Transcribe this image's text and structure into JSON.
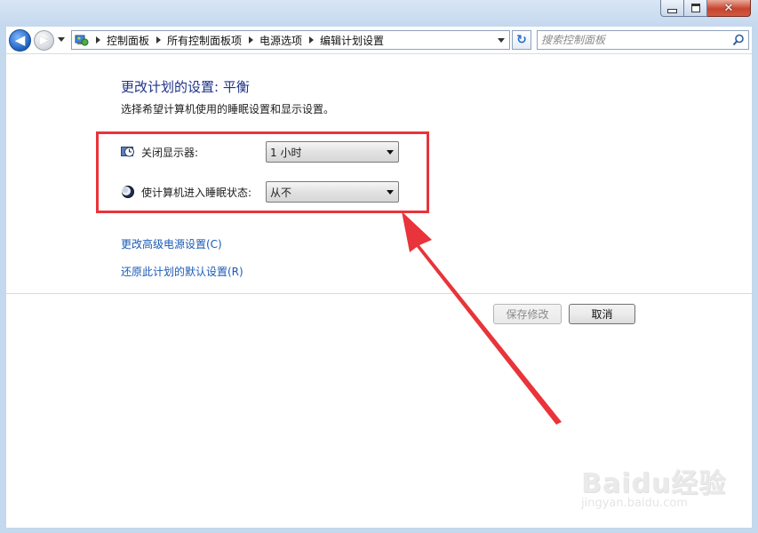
{
  "window": {
    "minimize_icon": "minimize-icon",
    "maximize_icon": "maximize-icon",
    "close_glyph": "✕"
  },
  "nav": {
    "back_glyph": "◀",
    "forward_glyph": "▶",
    "breadcrumbs": [
      "控制面板",
      "所有控制面板项",
      "电源选项",
      "编辑计划设置"
    ],
    "refresh_glyph": "↻",
    "search_placeholder": "搜索控制面板"
  },
  "main": {
    "title": "更改计划的设置: 平衡",
    "description": "选择希望计算机使用的睡眠设置和显示设置。",
    "settings": [
      {
        "label": "关闭显示器:",
        "value": "1 小时",
        "icon": "display-clock-icon"
      },
      {
        "label": "使计算机进入睡眠状态:",
        "value": "从不",
        "icon": "moon-sleep-icon"
      }
    ],
    "links": {
      "advanced": "更改高级电源设置(C)",
      "restore": "还原此计划的默认设置(R)"
    },
    "buttons": {
      "save": "保存修改",
      "save_enabled": false,
      "cancel": "取消"
    }
  },
  "annotation": {
    "color": "#e8343a"
  },
  "watermark": {
    "main": "Baidu经验",
    "sub": "jingyan.baidu.com"
  },
  "colors": {
    "title_blue": "#1e3287",
    "link_blue": "#1a5bb5",
    "frame": "#c4d8ee"
  }
}
